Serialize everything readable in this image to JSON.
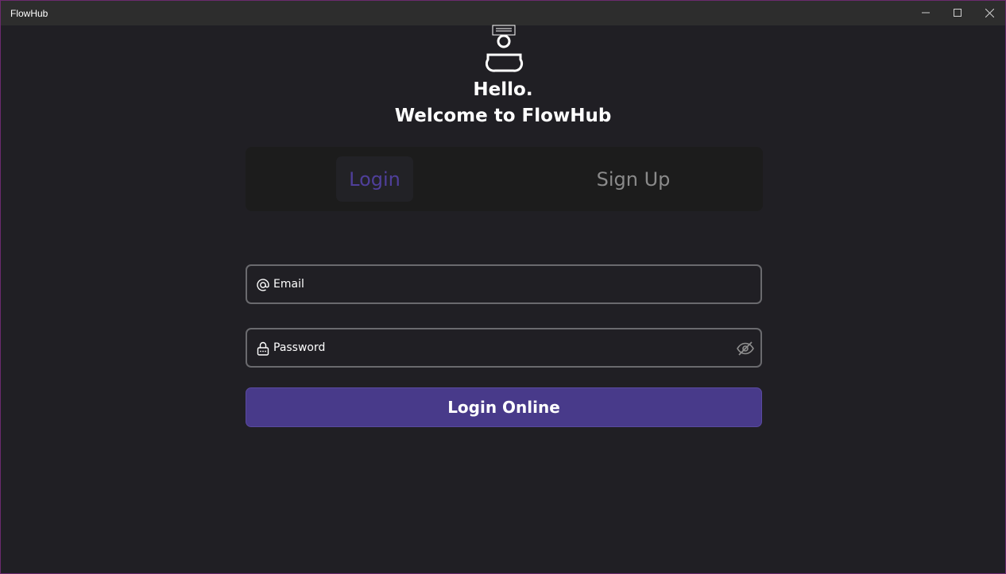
{
  "window": {
    "title": "FlowHub",
    "controls": {
      "minimize_icon": "minimize-icon",
      "maximize_icon": "maximize-icon",
      "close_icon": "close-icon"
    }
  },
  "header": {
    "logo_icon": "user-avatar-icon",
    "greeting_line1": "Hello.",
    "greeting_line2": "Welcome to FlowHub"
  },
  "tabs": {
    "login_label": "Login",
    "signup_label": "Sign Up",
    "active": "Login"
  },
  "form": {
    "email": {
      "placeholder": "Email",
      "icon": "at-icon"
    },
    "password": {
      "placeholder": "Password",
      "icon": "lock-icon",
      "toggle_icon": "eye-off-icon"
    },
    "submit_label": "Login Online"
  },
  "colors": {
    "background": "#201f24",
    "titlebar": "#2d2d2d",
    "accent": "#483a8a",
    "active_tab_text": "#4f3f9a",
    "inactive_tab_text": "#8a8a8a",
    "field_border": "#6a6a6e"
  }
}
